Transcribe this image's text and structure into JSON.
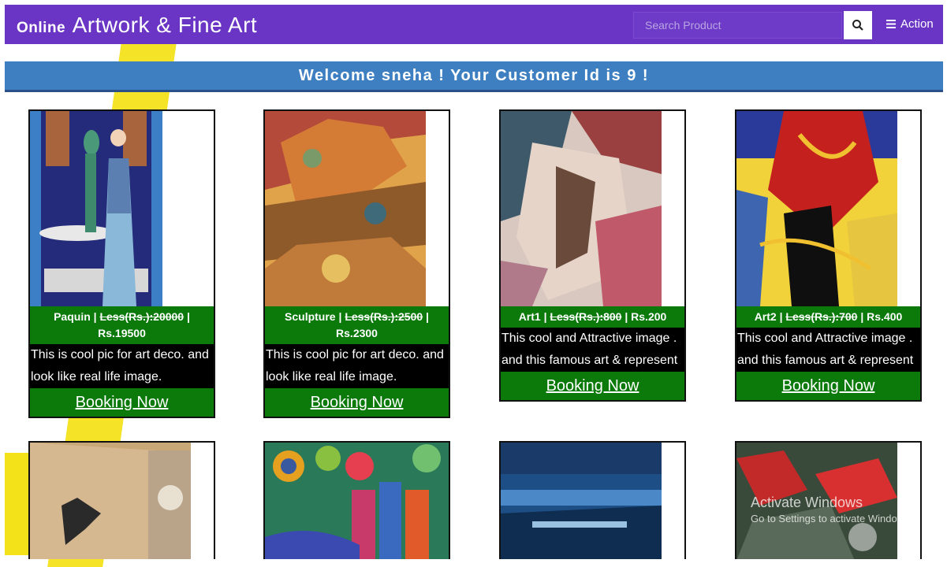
{
  "header": {
    "brand_small": "Online",
    "brand_big": "Artwork & Fine Art",
    "search_placeholder": "Search Product",
    "action_label": "Action"
  },
  "welcome": "Welcome sneha ! Your Customer Id is 9 !",
  "products": [
    {
      "name": "Paquin",
      "old_price": "Less(Rs.):20000",
      "new_price": "Rs.19500",
      "desc1": "This is cool pic for art deco. and",
      "desc2": "look like real life image.",
      "cta": "Booking Now"
    },
    {
      "name": "Sculpture",
      "old_price": "Less(Rs.):2500",
      "new_price": "Rs.2300",
      "desc1": "This is cool pic for art deco. and",
      "desc2": "look like real life image.",
      "cta": "Booking Now"
    },
    {
      "name": "Art1",
      "old_price": "Less(Rs.):800",
      "new_price": "Rs.200",
      "desc1": "This cool and Attractive image .",
      "desc2": "and this famous art & represent",
      "cta": "Booking Now"
    },
    {
      "name": "Art2",
      "old_price": "Less(Rs.):700",
      "new_price": "Rs.400",
      "desc1": "This cool and Attractive image .",
      "desc2": "and this famous art & represent",
      "cta": "Booking Now"
    }
  ],
  "watermark": {
    "line1": "Activate Windows",
    "line2": "Go to Settings to activate Windows."
  },
  "colors": {
    "topbar": "#6a35c4",
    "welcome_bar": "#3d7fc1",
    "card_green": "#0b7a0b"
  }
}
